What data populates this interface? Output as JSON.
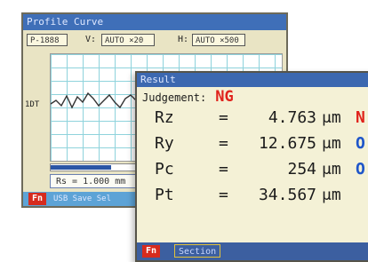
{
  "profile_window": {
    "title": "Profile Curve",
    "filter_label": "P-1888",
    "v_label": "V:",
    "v_value": "AUTO ×20",
    "h_label": "H:",
    "h_value": "AUTO ×500",
    "y_tick": "1DT",
    "rs_value": "Rs = 1.000 mm",
    "fn_label": "Fn",
    "fn_action": "USB Save Sel"
  },
  "result_window": {
    "title": "Result",
    "judgement_label": "Judgement:",
    "judgement_value": "NG",
    "rows": [
      {
        "name": "Rz",
        "eq": "=",
        "value": "4.763",
        "unit": "μm",
        "status": "N"
      },
      {
        "name": "Ry",
        "eq": "=",
        "value": "12.675",
        "unit": "μm",
        "status": "O"
      },
      {
        "name": "Pc",
        "eq": "=",
        "value": "254",
        "unit": "μm",
        "status": "O"
      },
      {
        "name": "Pt",
        "eq": "=",
        "value": "34.567",
        "unit": "μm",
        "status": ""
      }
    ],
    "fn_label": "Fn",
    "section_label": "Section"
  },
  "colors": {
    "status_ng": "#e0231c",
    "status_ok": "#1f56c9"
  }
}
